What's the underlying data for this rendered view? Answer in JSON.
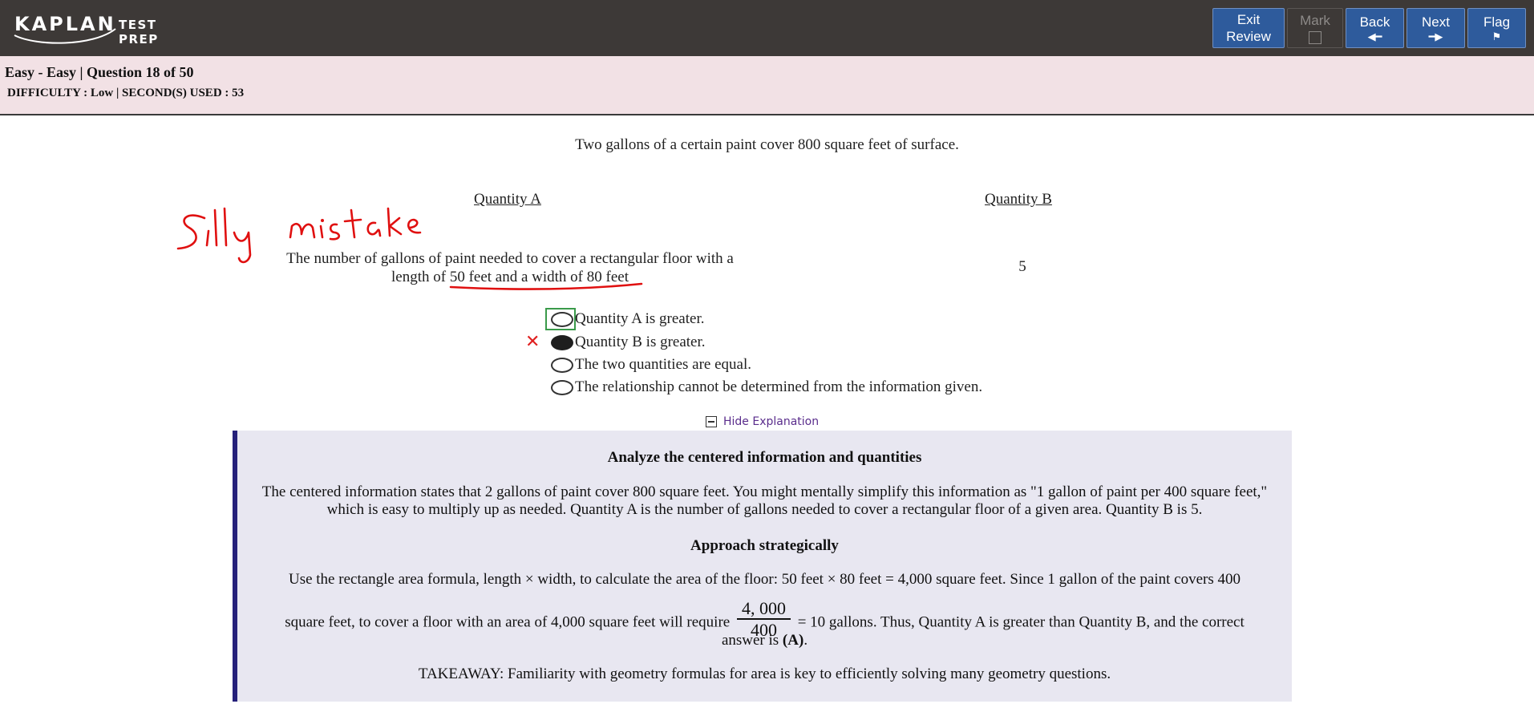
{
  "header": {
    "logo_word": "KAPLAN",
    "logo_sub": "TEST PREP",
    "buttons": {
      "exit_line1": "Exit",
      "exit_line2": "Review",
      "mark": "Mark",
      "back": "Back",
      "next": "Next",
      "flag": "Flag"
    },
    "icons": {
      "back": "arrow-left-icon",
      "next": "arrow-right-icon",
      "flag": "flag-icon",
      "mark": "checkbox-icon"
    },
    "colors": {
      "bar": "#3d3937",
      "button": "#2e5b9c"
    }
  },
  "info": {
    "title": "Easy - Easy | Question 18 of 50",
    "meta": "DIFFICULTY : Low | SECOND(S) USED : 53",
    "background": "#f2e1e5"
  },
  "question": {
    "stem": "Two gallons of a certain paint cover 800 square feet of surface.",
    "quantity_a_label": "Quantity A",
    "quantity_b_label": "Quantity B",
    "quantity_a_text_1": "The number of gallons of paint needed to cover a rectangular floor with a",
    "quantity_a_text_2": "length of 50 feet and a width of 80 feet",
    "quantity_b_value": "5",
    "choices": [
      {
        "label": "Quantity A is greater.",
        "selected": false,
        "correct": true
      },
      {
        "label": "Quantity B is greater.",
        "selected": true,
        "correct": false
      },
      {
        "label": "The two quantities are equal.",
        "selected": false,
        "correct": false
      },
      {
        "label": "The relationship cannot be determined from the information given.",
        "selected": false,
        "correct": false
      }
    ],
    "wrong_mark": "✕",
    "annotation": "Silly mistake"
  },
  "explanation": {
    "toggle_label": "Hide Explanation",
    "heading_1": "Analyze the centered information and quantities",
    "para_1": "The centered information states that 2 gallons of paint cover 800 square feet. You might mentally simplify this information as \"1 gallon of paint per 400 square feet,\" which is easy to multiply up as needed. Quantity A is the number of gallons needed to cover a rectangular floor of a given area. Quantity B is 5.",
    "heading_2": "Approach strategically",
    "para_2_line1": "Use the rectangle area formula, length × width, to calculate the area of the floor: 50 feet × 80 feet = 4,000 square feet. Since 1 gallon of the paint covers 400",
    "para_2_pre": "square feet, to cover a floor with an area of 4,000 square feet will require",
    "frac_num": "4, 000",
    "frac_den": "400",
    "para_2_post": "= 10 gallons. Thus, Quantity A is greater than Quantity B, and the correct",
    "para_2_line3_pre": "answer is",
    "para_2_answer": "(A)",
    "para_2_line3_post": ".",
    "takeaway": "TAKEAWAY: Familiarity with geometry formulas for area is key to efficiently solving many geometry questions.",
    "accent": "#25207a",
    "background": "#e8e7f1"
  }
}
